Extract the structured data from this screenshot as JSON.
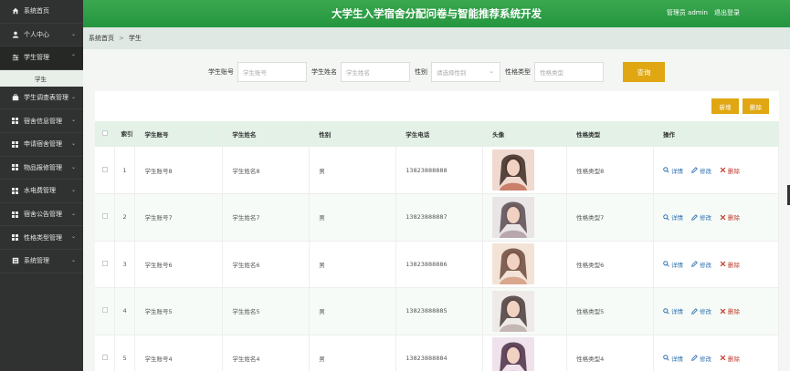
{
  "header": {
    "title": "大学生入学宿舍分配问卷与智能推荐系统开发",
    "user": "管理员 admin",
    "logout": "退出登录"
  },
  "sidebar": {
    "items": [
      {
        "label": "系统首页",
        "icon": "home-icon"
      },
      {
        "label": "个人中心",
        "icon": "user-icon"
      },
      {
        "label": "学生管理",
        "icon": "sliders-icon"
      },
      {
        "label": "学生调查表管理",
        "icon": "briefcase-icon"
      },
      {
        "label": "宿舍信息管理",
        "icon": "grid-icon"
      },
      {
        "label": "申请宿舍管理",
        "icon": "grid-icon"
      },
      {
        "label": "物品报修管理",
        "icon": "grid-icon"
      },
      {
        "label": "水电费管理",
        "icon": "grid-icon"
      },
      {
        "label": "宿舍公告管理",
        "icon": "grid-icon"
      },
      {
        "label": "性格类型管理",
        "icon": "grid-icon"
      },
      {
        "label": "系统管理",
        "icon": "list-icon"
      }
    ],
    "sub_item": "学生"
  },
  "breadcrumb": {
    "home": "系统首页",
    "separator": ">",
    "current": "学生"
  },
  "search": {
    "account_label": "学生账号",
    "account_placeholder": "学生账号",
    "name_label": "学生姓名",
    "name_placeholder": "学生姓名",
    "gender_label": "性别",
    "gender_placeholder": "请选择性别",
    "type_label": "性格类型",
    "type_placeholder": "性格类型",
    "button": "查询"
  },
  "actions": {
    "add": "新增",
    "delete": "删除"
  },
  "table": {
    "headers": [
      "索引",
      "学生账号",
      "学生姓名",
      "性别",
      "学生电话",
      "头像",
      "性格类型",
      "操作"
    ],
    "rows": [
      {
        "index": "1",
        "account": "学生账号8",
        "name": "学生姓名8",
        "gender": "男",
        "phone": "13823888888",
        "type": "性格类型8"
      },
      {
        "index": "2",
        "account": "学生账号7",
        "name": "学生姓名7",
        "gender": "男",
        "phone": "13823888887",
        "type": "性格类型7"
      },
      {
        "index": "3",
        "account": "学生账号6",
        "name": "学生姓名6",
        "gender": "男",
        "phone": "13823888886",
        "type": "性格类型6"
      },
      {
        "index": "4",
        "account": "学生账号5",
        "name": "学生姓名5",
        "gender": "男",
        "phone": "13823888885",
        "type": "性格类型5"
      },
      {
        "index": "5",
        "account": "学生账号4",
        "name": "学生姓名4",
        "gender": "男",
        "phone": "13823888884",
        "type": "性格类型4"
      }
    ],
    "ops": {
      "detail": "详情",
      "edit": "修改",
      "del": "删除"
    }
  },
  "colors": {
    "header_green": "#2aa34a",
    "sidebar_bg": "#2f3230",
    "accent_gold": "#e0a712",
    "table_head_bg": "#e3f1e6"
  }
}
